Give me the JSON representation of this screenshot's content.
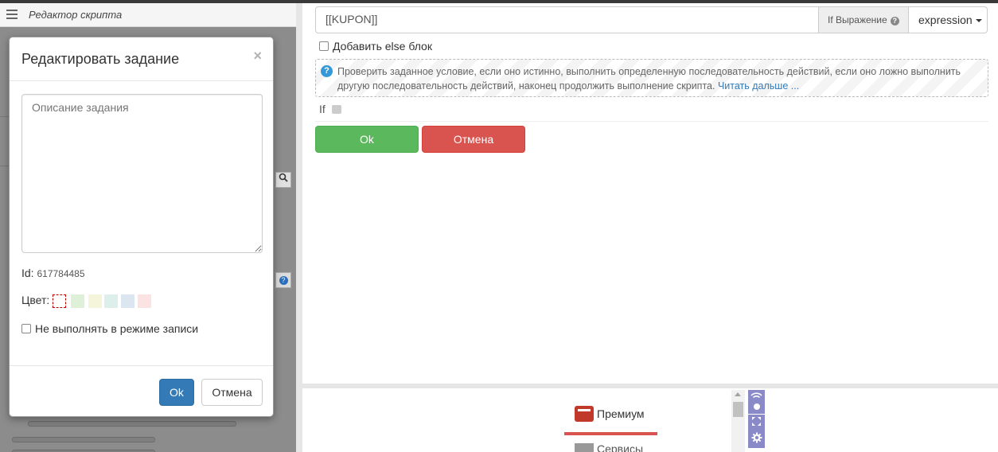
{
  "left_panel": {
    "title": "Редактор скрипта"
  },
  "modal": {
    "title": "Редактировать задание",
    "close_glyph": "×",
    "description_placeholder": "Описание задания",
    "id_label": "Id:",
    "id_value": "617784485",
    "color_label": "Цвет:",
    "colors": [
      "#ffffff",
      "#dff0d8",
      "#f5f5dc",
      "#dcefea",
      "#dce6f0",
      "#fbe3e4"
    ],
    "no_record_label": "Не выполнять в режиме записи",
    "ok_label": "Ok",
    "cancel_label": "Отмена"
  },
  "editor": {
    "expression_value": "[[KUPON]]",
    "addon_label": "If Выражение",
    "dropdown_label": "expression",
    "else_label": "Добавить else блок",
    "info_text": "Проверить заданное условие, если оно истинно, выполнить определенную последовательность действий, если оно ложно выполнить другую последовательность действий, наконец продолжить выполнение скрипта.",
    "info_link": "Читать дальше ...",
    "if_label": "If",
    "ok_label": "Ok",
    "cancel_label": "Отмена"
  },
  "bottom": {
    "premium_label": "Премиум",
    "services_label": "Сервисы"
  },
  "icons": {
    "menu": "hamburger-icon",
    "search": "search-icon",
    "help": "question-icon",
    "wifi": "wifi-icon",
    "record": "record-icon",
    "expand": "expand-icon",
    "settings": "gear-icon"
  }
}
